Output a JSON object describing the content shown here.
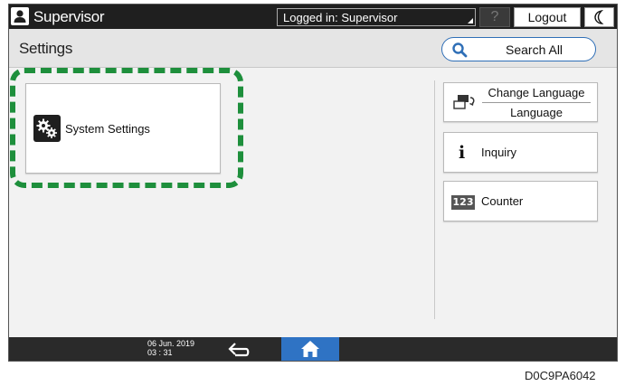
{
  "topbar": {
    "user_icon": "user-icon",
    "user_name": "Supervisor",
    "login_status": "Logged in: Supervisor",
    "help_label": "?",
    "logout_label": "Logout",
    "display_mode_icon": "moon-icon"
  },
  "header": {
    "title": "Settings",
    "search_icon": "search-icon",
    "search_label": "Search All"
  },
  "main": {
    "system_settings": {
      "icon": "gears-icon",
      "label": "System Settings"
    },
    "side_buttons": {
      "change_language": {
        "icon": "language-switch-icon",
        "label": "Change Language",
        "value": "Language"
      },
      "inquiry": {
        "icon": "info-icon",
        "glyph": "i",
        "label": "Inquiry"
      },
      "counter": {
        "icon": "counter-icon",
        "glyph": "123",
        "label": "Counter"
      }
    }
  },
  "bottombar": {
    "date": "06 Jun. 2019",
    "time": "03 : 31",
    "back_icon": "back-arrow-icon",
    "home_icon": "home-icon"
  },
  "caption": "D0C9PA6042",
  "colors": {
    "highlight": "#1e8f3c",
    "accent_blue": "#2f73c4",
    "bar_dark": "#1f1f1f"
  }
}
